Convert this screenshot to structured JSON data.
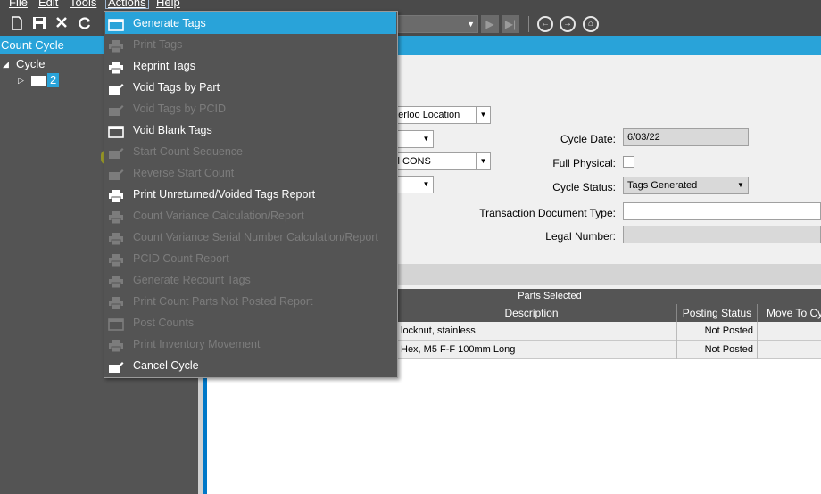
{
  "menubar": {
    "file": "File",
    "edit": "Edit",
    "tools": "Tools",
    "actions": "Actions",
    "help": "Help"
  },
  "toolbar": {
    "icons": [
      "new-icon",
      "save-icon",
      "delete-icon",
      "refresh-icon",
      "previous-icon",
      "next-icon",
      "home-icon"
    ]
  },
  "tree": {
    "header": "Count Cycle",
    "root_label": "Cycle",
    "child_label": "2"
  },
  "form": {
    "warehouse_value": "aterloo Location",
    "group_value": "all CONS",
    "cycle_date_label": "Cycle Date:",
    "cycle_date_value": "6/03/22",
    "full_physical_label": "Full Physical:",
    "cycle_status_label": "Cycle Status:",
    "cycle_status_value": "Tags Generated",
    "transaction_doc_type_label": "Transaction Document Type:",
    "legal_number_label": "Legal Number:"
  },
  "grid": {
    "title": "Parts Selected",
    "columns": [
      "Description",
      "Posting Status",
      "Move To Cy"
    ],
    "rows": [
      {
        "description": "locknut, stainless",
        "posting_status": "Not Posted"
      },
      {
        "description": "Hex, M5 F-F 100mm Long",
        "posting_status": "Not Posted"
      }
    ]
  },
  "actions_menu": {
    "items": [
      {
        "label": "Generate Tags",
        "enabled": true,
        "selected": true,
        "icon": "window-icon"
      },
      {
        "label": "Print Tags",
        "enabled": false,
        "icon": "printer-icon"
      },
      {
        "label": "Reprint Tags",
        "enabled": true,
        "icon": "printer-icon"
      },
      {
        "label": "Void Tags by Part",
        "enabled": true,
        "icon": "edit-icon"
      },
      {
        "label": "Void Tags by PCID",
        "enabled": false,
        "icon": "edit-icon"
      },
      {
        "label": "Void Blank Tags",
        "enabled": true,
        "icon": "window-icon"
      },
      {
        "label": "Start Count Sequence",
        "enabled": false,
        "icon": "edit-icon"
      },
      {
        "label": "Reverse Start Count",
        "enabled": false,
        "icon": "edit-icon"
      },
      {
        "label": "Print Unreturned/Voided Tags Report",
        "enabled": true,
        "icon": "printer-icon"
      },
      {
        "label": "Count Variance Calculation/Report",
        "enabled": false,
        "icon": "printer-icon"
      },
      {
        "label": "Count Variance Serial Number Calculation/Report",
        "enabled": false,
        "icon": "printer-icon"
      },
      {
        "label": "PCID Count Report",
        "enabled": false,
        "icon": "printer-icon"
      },
      {
        "label": "Generate Recount Tags",
        "enabled": false,
        "icon": "printer-icon"
      },
      {
        "label": "Print Count Parts Not Posted Report",
        "enabled": false,
        "icon": "printer-icon"
      },
      {
        "label": "Post Counts",
        "enabled": false,
        "icon": "window-icon"
      },
      {
        "label": "Print Inventory Movement",
        "enabled": false,
        "icon": "printer-icon"
      },
      {
        "label": "Cancel Cycle",
        "enabled": true,
        "icon": "edit-icon"
      }
    ]
  },
  "colors": {
    "accent": "#29a3d9",
    "dark_bg": "#545454",
    "highlight": "#c8c800"
  }
}
